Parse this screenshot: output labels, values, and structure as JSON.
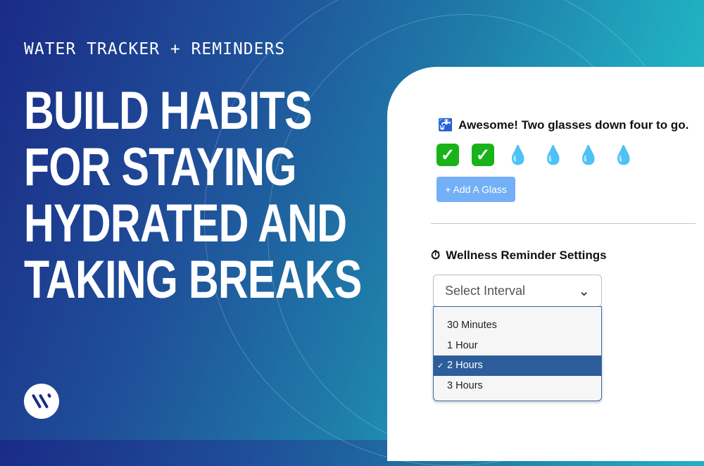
{
  "hero": {
    "eyebrow": "WATER TRACKER + REMINDERS",
    "headline_lines": [
      "BUILD HABITS",
      "FOR STAYING",
      "HYDRATED AND",
      "TAKING BREAKS"
    ]
  },
  "tracker": {
    "status_icon": "faucet-glass-icon",
    "status_text": "Awesome! Two glasses down four to go.",
    "glasses_completed": 2,
    "glasses_total": 6,
    "glasses": [
      "check",
      "check",
      "drop",
      "drop",
      "drop",
      "drop"
    ],
    "add_button_label": "+ Add A Glass"
  },
  "settings": {
    "title_icon": "stopwatch-icon",
    "title": "Wellness Reminder Settings",
    "select_placeholder": "Select Interval",
    "options": [
      "30 Minutes",
      "1 Hour",
      "2 Hours",
      "3 Hours"
    ],
    "selected_option": "2 Hours",
    "check_glyph": "✓"
  },
  "glyphs": {
    "check": "✓",
    "drop": "💧",
    "faucet": "🚰",
    "stopwatch": "⏱",
    "chevron": "⌄"
  }
}
